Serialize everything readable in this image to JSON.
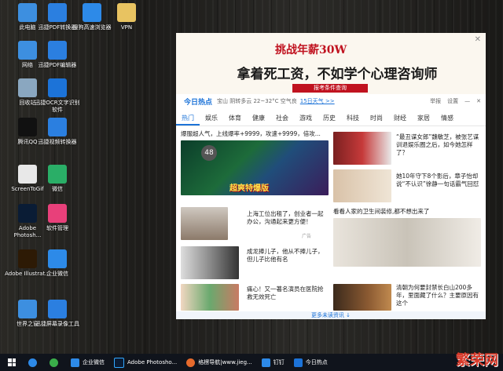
{
  "desktop": {
    "icons": [
      {
        "label": "此电脑",
        "icon": "computer-icon",
        "color": "#3d8fe0"
      },
      {
        "label": "迅捷PDF转换器",
        "icon": "pdf-converter-icon",
        "color": "#2b7fe0"
      },
      {
        "label": "搜狗高速浏览器",
        "icon": "sogou-browser-icon",
        "color": "#2d8ae8"
      },
      {
        "label": "VPN",
        "icon": "folder-icon",
        "color": "#e8c361"
      },
      {
        "label": "网络",
        "icon": "network-icon",
        "color": "#3d8fe0"
      },
      {
        "label": "迅捷PDF编辑器",
        "icon": "pdf-editor-icon",
        "color": "#2b7fe0"
      },
      {
        "label": "回收站",
        "icon": "recycle-bin-icon",
        "color": "#8aa7c0"
      },
      {
        "label": "迅捷OCR文字识别软件",
        "icon": "ocr-icon",
        "color": "#1c73d8"
      },
      {
        "label": "腾讯QQ",
        "icon": "qq-icon",
        "color": "#111111"
      },
      {
        "label": "迅捷视频转换器",
        "icon": "video-converter-icon",
        "color": "#2b7fe0"
      },
      {
        "label": "ScreenToGif",
        "icon": "screentogif-icon",
        "color": "#e8e8e8"
      },
      {
        "label": "微信",
        "icon": "wechat-icon",
        "color": "#2aae67"
      },
      {
        "label": "Adobe Photosh...",
        "icon": "photoshop-icon",
        "color": "#0a1c35"
      },
      {
        "label": "软件管理",
        "icon": "software-manager-icon",
        "color": "#e8407a"
      },
      {
        "label": "Adobe Illustrat...",
        "icon": "illustrator-icon",
        "color": "#2d1a05"
      },
      {
        "label": "企业微信",
        "icon": "wecom-icon",
        "color": "#2d8ae8"
      },
      {
        "label": "世界之窗",
        "icon": "theworld-browser-icon",
        "color": "#3d8fe0"
      },
      {
        "label": "迅捷屏幕录像工具",
        "icon": "screen-recorder-icon",
        "color": "#2b7fe0"
      }
    ]
  },
  "popup": {
    "ad": {
      "headline_prefix": "挑战年薪",
      "headline_value": "30W",
      "main": "拿着死工资，不如学个心理咨询师",
      "button": "报考条件查询"
    },
    "header": {
      "logo": "今日热点",
      "weather": "宝山  阴转多云  22~32°C  空气良",
      "forecast_link": "15日天气 >>",
      "actions": [
        "举报",
        "设置",
        "—",
        "✕"
      ]
    },
    "tabs": [
      "热门",
      "娱乐",
      "体育",
      "健康",
      "社会",
      "游戏",
      "历史",
      "科技",
      "时尚",
      "财经",
      "家居",
      "情感"
    ],
    "news": {
      "left_top": "爆服超人气，上线爆率+9999，攻速+9999，倍攻...",
      "badge_number": "48",
      "game_banner_text": "超爽特爆版",
      "item1": "上海工位出租了，创业者一起办公，沟通起来更方便！",
      "item1_tag": "广告",
      "item2": "成龙捧儿子，他从不捧儿子，但儿子比他有名",
      "item3": "痛心！又一著名演员在医院抢救无效死亡",
      "right1": "“最丑谋女郎”魏敏芝，被张艺谋训退娱乐圈之后，如今她怎样了？",
      "right2": "她10年守下8个影后，章子怡却说“不认识”徐静一句话霸气回怼",
      "right3": "看看人家的卫生间装修,都不想出来了",
      "right4": "清朝为何要封禁长白山200多年，里面藏了什么？主要原因有这个",
      "more": "更多未读资讯 ↓"
    }
  },
  "taskbar": {
    "items": [
      "企业微信",
      "Adobe Photosho...",
      "格楞导航|www.jieg...",
      "钉钉",
      "今日热点"
    ]
  },
  "watermark": "繁荣网"
}
